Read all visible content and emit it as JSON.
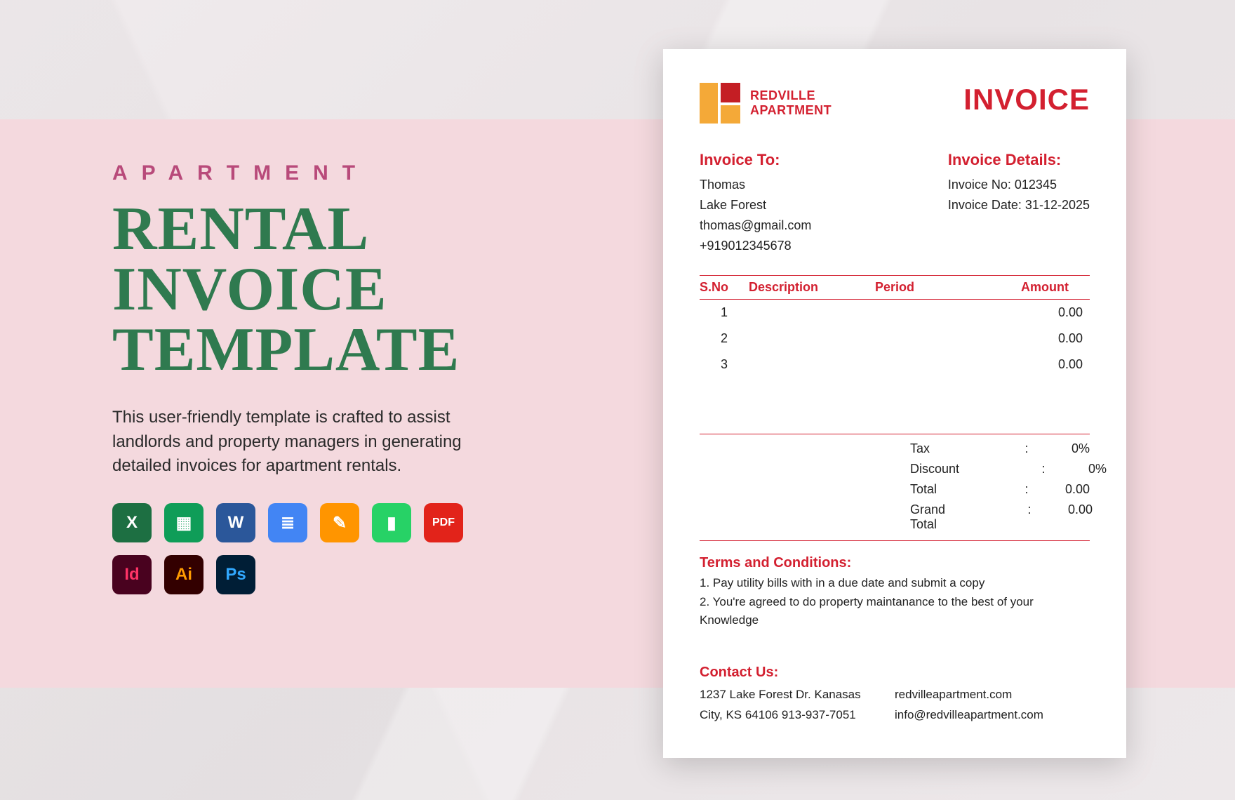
{
  "promo": {
    "eyebrow": "APARTMENT",
    "headline": "RENTAL INVOICE TEMPLATE",
    "description": "This user-friendly template is crafted to assist landlords and property managers in generating detailed invoices for apartment rentals.",
    "icons_row1": [
      "excel",
      "sheets",
      "word",
      "docs",
      "pages",
      "numbers",
      "pdf"
    ],
    "icons_row2": [
      "indesign",
      "illustrator",
      "photoshop"
    ],
    "icon_labels": {
      "excel": "X",
      "sheets": "▦",
      "word": "W",
      "docs": "≣",
      "pages": "✎",
      "numbers": "▮",
      "pdf": "PDF",
      "indesign": "Id",
      "illustrator": "Ai",
      "photoshop": "Ps"
    }
  },
  "invoice": {
    "brand_line1": "REDVILLE",
    "brand_line2": "APARTMENT",
    "title": "INVOICE",
    "to_head": "Invoice To:",
    "to_name": "Thomas",
    "to_city": "Lake Forest",
    "to_email": "thomas@gmail.com",
    "to_phone": "+919012345678",
    "details_head": "Invoice Details:",
    "invoice_no_label": "Invoice No: 012345",
    "invoice_date_label": "Invoice Date: 31-12-2025",
    "columns": {
      "sno": "S.No",
      "desc": "Description",
      "period": "Period",
      "amount": "Amount"
    },
    "rows": [
      {
        "sno": "1",
        "desc": "",
        "period": "",
        "amount": "0.00"
      },
      {
        "sno": "2",
        "desc": "",
        "period": "",
        "amount": "0.00"
      },
      {
        "sno": "3",
        "desc": "",
        "period": "",
        "amount": "0.00"
      }
    ],
    "totals": {
      "tax_label": "Tax",
      "tax_value": "0%",
      "discount_label": "Discount",
      "discount_value": "0%",
      "total_label": "Total",
      "total_value": "0.00",
      "grand_label": "Grand Total",
      "grand_value": "0.00"
    },
    "terms_head": "Terms and Conditions:",
    "terms_1": "1. Pay utility bills with in a due date and submit a copy",
    "terms_2": "2. You're agreed to do property maintanance to the best of your Knowledge",
    "contact_head": "Contact Us:",
    "contact_addr1": "1237 Lake Forest Dr. Kanasas",
    "contact_addr2": "City, KS 64106 913-937-7051",
    "contact_web": "redvilleapartment.com",
    "contact_email": "info@redvilleapartment.com"
  }
}
